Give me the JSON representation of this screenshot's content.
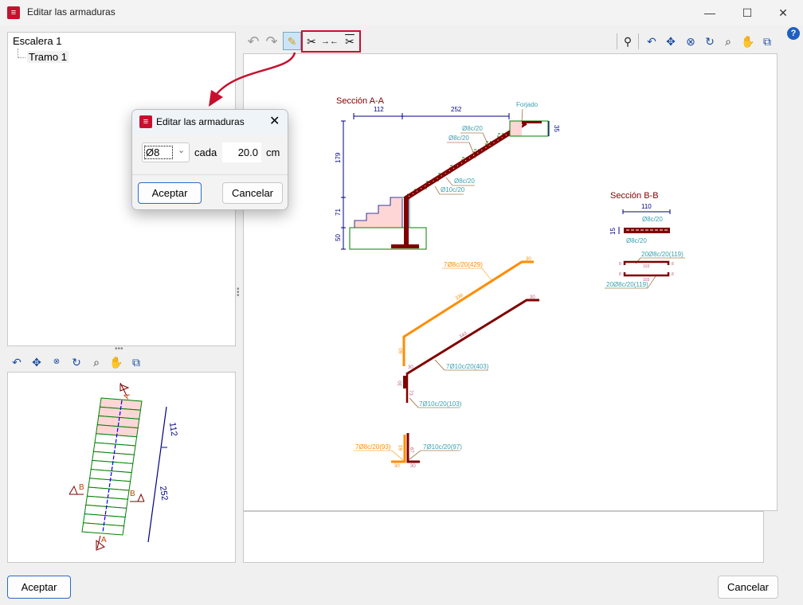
{
  "window": {
    "title": "Editar las armaduras",
    "minimize": "—",
    "maximize": "☐",
    "close": "✕"
  },
  "tree": {
    "root": "Escalera 1",
    "child": "Tramo 1"
  },
  "toolbar": {
    "undo": "↶",
    "redo": "↷",
    "help": "?"
  },
  "drawing": {
    "section_a_title": "Sección A-A",
    "dim_112": "112",
    "dim_252": "252",
    "dim_179": "179",
    "dim_71": "71",
    "dim_50": "50",
    "dim_35": "35",
    "forjado": "Forjado",
    "lbl_a1": "Ø8c/20",
    "lbl_a2": "Ø8c/20",
    "lbl_a3": "Ø8c/20",
    "lbl_a4": "Ø10c/20",
    "section_b_title": "Sección B-B",
    "dim_110": "110",
    "dim_15": "15",
    "lbl_b1": "Ø8c/20",
    "lbl_b2": "Ø8c/20",
    "bar_b1": "20Ø8c/20(119)",
    "bar_b2": "20Ø8c/20(119)",
    "bar_b_len1": "103",
    "bar_b_len2": "103",
    "bar_b_end": "8",
    "bar1": "7Ø8c/20(429)",
    "bar1_len": "339",
    "bar1_leg": "60",
    "bar1_end": "30",
    "bar2": "7Ø10c/20(403)",
    "bar2_len": "343",
    "bar2_end": "30",
    "bar2_start": "30",
    "bar3": "7Ø10c/20(103)",
    "bar3_a": "30",
    "bar3_b": "73",
    "bar4": "7Ø8c/20(93)",
    "bar4_a": "63",
    "bar4_b": "30",
    "bar5": "7Ø10c/20(97)",
    "bar5_a": "67",
    "bar5_b": "30"
  },
  "plan": {
    "dim_112": "112",
    "dim_252": "252",
    "mark_a": "A",
    "mark_b": "B"
  },
  "dialog": {
    "title": "Editar las armaduras",
    "diameter": "Ø8",
    "cada": "cada",
    "spacing": "20.0",
    "unit": "cm",
    "accept": "Aceptar",
    "cancel": "Cancelar"
  },
  "footer": {
    "accept": "Aceptar",
    "cancel": "Cancelar"
  },
  "colors": {
    "accent": "#c8102e",
    "rebar": "#800000",
    "rebar_alt": "#ff8c00",
    "concrete": "#ffd6d6",
    "dim": "#000080",
    "label": "#3aa0b0"
  }
}
